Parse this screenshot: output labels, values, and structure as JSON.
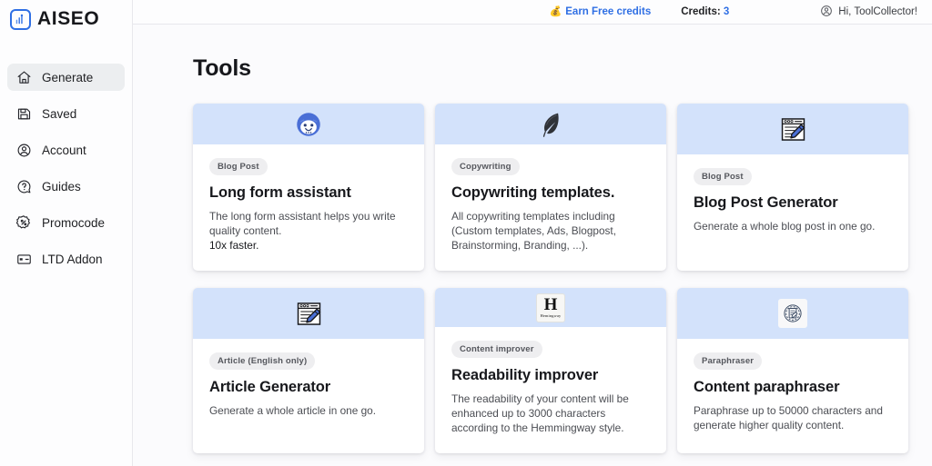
{
  "brand": {
    "name": "AISEO",
    "mark_icon": "chart-logo-icon"
  },
  "sidebar": {
    "items": [
      {
        "label": "Generate",
        "icon": "home-icon",
        "active": true
      },
      {
        "label": "Saved",
        "icon": "floppy-disk-icon",
        "active": false
      },
      {
        "label": "Account",
        "icon": "user-circle-icon",
        "active": false
      },
      {
        "label": "Guides",
        "icon": "question-circle-icon",
        "active": false
      },
      {
        "label": "Promocode",
        "icon": "percent-badge-icon",
        "active": false
      },
      {
        "label": "LTD Addon",
        "icon": "credit-card-icon",
        "active": false
      }
    ]
  },
  "topbar": {
    "earn_credits_label": "Earn Free credits",
    "earn_credits_icon": "money-bag-icon",
    "credits_label": "Credits:",
    "credits_value": "3",
    "user_icon": "user-circle-icon",
    "user_greeting": "Hi, ToolCollector!"
  },
  "main": {
    "page_title": "Tools",
    "cards": [
      {
        "icon": "robot-face-icon",
        "badge": "Blog Post",
        "title": "Long form assistant",
        "desc": "The long form assistant helps you write quality content.",
        "desc_em": "10x faster."
      },
      {
        "icon": "feather-quill-icon",
        "badge": "Copywriting",
        "title": "Copywriting templates.",
        "desc": "All copywriting templates including (Custom templates, Ads, Blogpost, Brainstorming, Branding, ...).",
        "desc_em": ""
      },
      {
        "icon": "memo-window-pencil-icon",
        "badge": "Blog Post",
        "title": "Blog Post Generator",
        "desc": "Generate a whole blog post in one go.",
        "desc_em": ""
      },
      {
        "icon": "memo-window-pencil-icon",
        "badge": "Article (English only)",
        "title": "Article Generator",
        "desc": "Generate a whole article in one go.",
        "desc_em": ""
      },
      {
        "icon": "hemingway-logo-icon",
        "badge": "Content improver",
        "title": "Readability improver",
        "desc": "The readability of your content will be enhanced up to 3000 characters according to the Hemmingway style.",
        "desc_em": ""
      },
      {
        "icon": "paraphrase-document-icon",
        "badge": "Paraphraser",
        "title": "Content paraphraser",
        "desc": "Paraphrase up to 50000 characters and generate higher quality content.",
        "desc_em": ""
      }
    ]
  },
  "colors": {
    "accent": "#2f6fe4",
    "card_header": "#d3e2fb",
    "page_bg": "#fbfbfd",
    "pill_bg": "#eeeef0"
  }
}
